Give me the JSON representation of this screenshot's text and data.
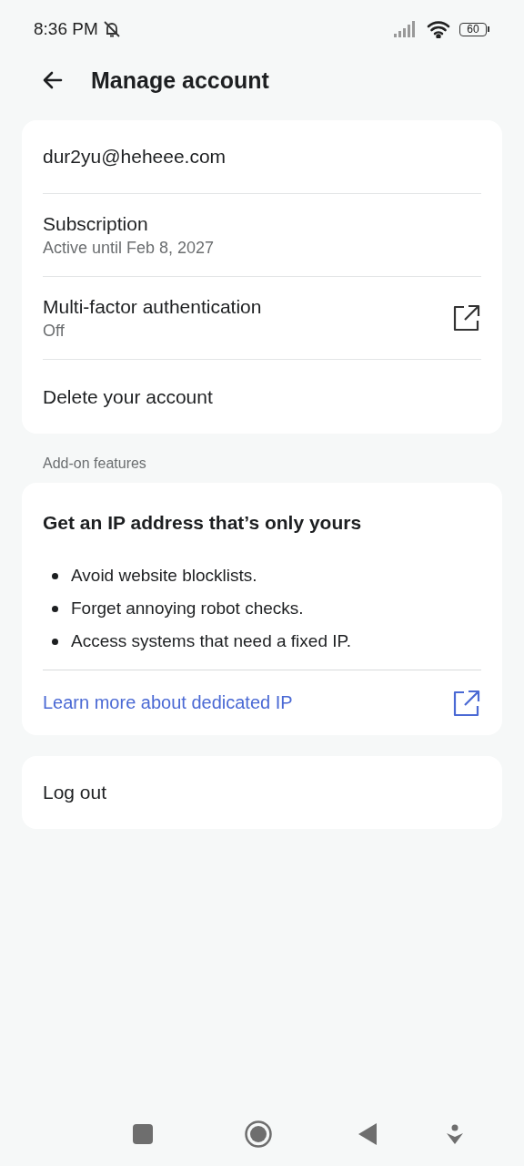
{
  "status_bar": {
    "time": "8:36 PM",
    "battery": "60"
  },
  "header": {
    "title": "Manage account"
  },
  "account": {
    "rows": [
      {
        "kind": "plain",
        "title": "dur2yu@heheee.com"
      },
      {
        "kind": "plain",
        "title": "Subscription",
        "subtitle": "Active until Feb 8, 2027"
      },
      {
        "kind": "external",
        "title": "Multi-factor authentication",
        "subtitle": "Off"
      },
      {
        "kind": "plain",
        "title": "Delete your account"
      }
    ]
  },
  "addons": {
    "section_label": "Add-on features",
    "title": "Get an IP address that’s only yours",
    "bullets": [
      "Avoid website blocklists.",
      "Forget annoying robot checks.",
      "Access systems that need a fixed IP."
    ],
    "link": "Learn more about dedicated IP"
  },
  "logout": {
    "label": "Log out"
  }
}
